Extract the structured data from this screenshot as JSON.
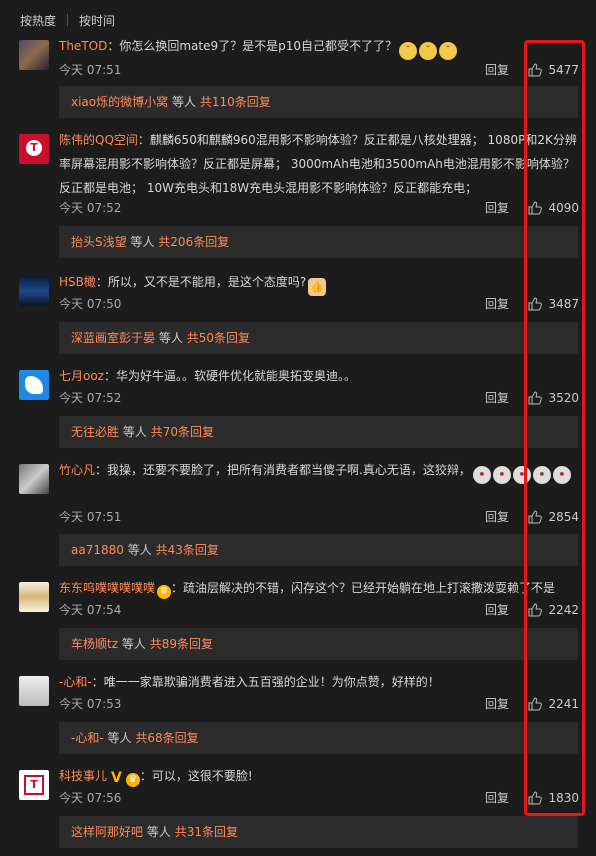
{
  "sort": {
    "hot": "按热度",
    "time": "按时间"
  },
  "reply_label": "回复",
  "others_label": "等人",
  "comments": [
    {
      "user": "TheTOD",
      "text": "你怎么换回mate9了？是不是p10自己都受不了了？",
      "emojis": [
        "doge",
        "doge",
        "doge"
      ],
      "time": "今天 07:51",
      "likes": "5477",
      "reply_user": "xiao烁的微博小窝",
      "reply_count": "共110条回复"
    },
    {
      "user": "陈伟的QQ空间",
      "text": "麒麟650和麒麟960混用影不影响体验？反正都是八核处理器；  1080P和2K分辨率屏幕混用影不影响体验？反正都是屏幕；  3000mAh电池和3500mAh电池混用影不影响体验？反正都是电池；  10W充电头和18W充电头混用影不影响体验？反正都能充电；",
      "time": "今天 07:52",
      "likes": "4090",
      "reply_user": "抬头S浅望",
      "reply_count": "共206条回复"
    },
    {
      "user": "HSB橄",
      "text": "所以，又不是不能用，是这个态度吗?",
      "emojis": [
        "thumb"
      ],
      "time": "今天 07:50",
      "likes": "3487",
      "reply_user": "深蓝画室彭于晏",
      "reply_count": "共50条回复"
    },
    {
      "user": "七月ooz",
      "text": "华为好牛逼。。软硬件优化就能奥拓变奥迪。。",
      "time": "今天 07:52",
      "likes": "3520",
      "reply_user": "无往必胜",
      "reply_count": "共70条回复"
    },
    {
      "user": "竹心凡",
      "text": "我操，还要不要脸了，把所有消费者都当傻子啊.真心无语，这狡辩，",
      "emojis": [
        "face",
        "face",
        "face",
        "face",
        "face"
      ],
      "time": "今天 07:51",
      "likes": "2854",
      "reply_user": "aa71880",
      "reply_count": "共43条回复"
    },
    {
      "user": "东东呜噗噗噗噗噗",
      "text": "疏油层解决的不错，闪存这个？已经开始躺在地上打滚撒泼耍赖了不是",
      "time": "今天 07:54",
      "likes": "2242",
      "reply_user": "车杨顺tz",
      "reply_count": "共89条回复"
    },
    {
      "user": "-心和-",
      "text": "唯一一家靠欺骗消费者进入五百强的企业！为你点赞，好样的！",
      "time": "今天 07:53",
      "likes": "2241",
      "reply_user": "-心和-",
      "reply_count": "共68条回复"
    },
    {
      "user": "科技事儿",
      "text": "可以，这很不要脸!",
      "time": "今天 07:56",
      "likes": "1830",
      "reply_user": "这样阿那好吧",
      "reply_count": "共31条回复"
    }
  ]
}
